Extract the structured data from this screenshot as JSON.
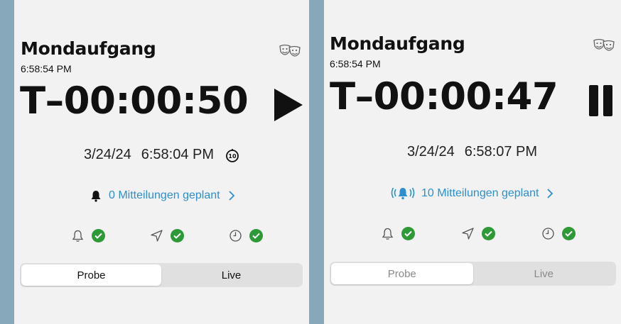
{
  "left": {
    "title": "Mondaufgang",
    "current_time": "6:58:54 PM",
    "countdown": "T–00:00:50",
    "date": "3/24/24",
    "time": "6:58:04 PM",
    "timer_badge": "10",
    "notifications": "0 Mitteilungen geplant",
    "segments": [
      "Probe",
      "Live"
    ],
    "selected_segment": "Probe"
  },
  "right": {
    "title": "Mondaufgang",
    "current_time": "6:58:54 PM",
    "countdown": "T–00:00:47",
    "date": "3/24/24",
    "time": "6:58:07 PM",
    "notifications": "10 Mitteilungen geplant",
    "segments": [
      "Probe",
      "Live"
    ],
    "selected_segment": "Probe"
  },
  "colors": {
    "accent_blue": "#2c8fce",
    "check_green": "#2e9a37",
    "separator": "#87a8b8",
    "panel_bg": "#f2f2f2"
  },
  "icons": {
    "header": "theater-masks-icon",
    "left_action": "play-icon",
    "right_action": "pause-icon",
    "left_notification": "bell-icon",
    "right_notification": "bell-ringing-icon",
    "status": [
      "bell-outline-icon",
      "location-arrow-icon",
      "clock-icon"
    ]
  }
}
